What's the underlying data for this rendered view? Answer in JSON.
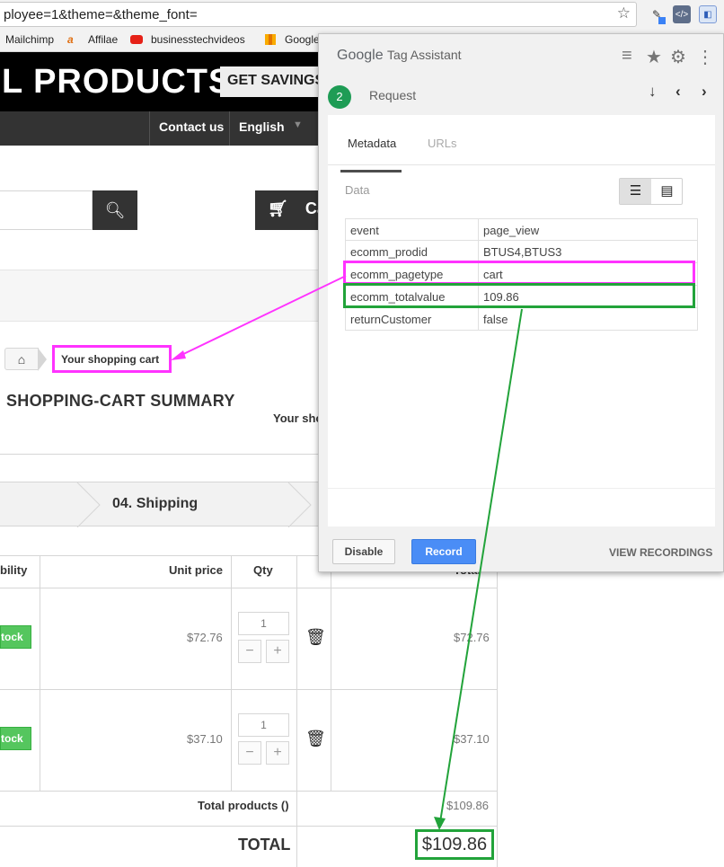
{
  "browser": {
    "url": "ployee=1&theme=&theme_font=",
    "bookmarks": [
      "Mailchimp",
      "Affilae",
      "businesstechvideos",
      "-",
      "Google"
    ]
  },
  "shop": {
    "title": "L PRODUCTS",
    "get_savings": "GET SAVINGS",
    "nav": [
      "Contact us",
      "English"
    ],
    "cart_label": "Ca",
    "breadcrumb_current": "Your shopping cart",
    "summary_title": "SHOPPING-CART SUMMARY",
    "your_sho": "Your sho",
    "step": "04. Shipping",
    "table": {
      "headers": [
        "bility",
        "Unit price",
        "Qty",
        "Total"
      ],
      "rows": [
        {
          "stock": "tock",
          "unit_price": "$72.76",
          "qty": "1",
          "total": "$72.76"
        },
        {
          "stock": "tock",
          "unit_price": "$37.10",
          "qty": "1",
          "total": "$37.10"
        }
      ],
      "total_products_label": "Total products ()",
      "total_products_value": "$109.86",
      "total_label": "TOTAL",
      "total_value": "$109.86"
    }
  },
  "tag_assistant": {
    "logo_google": "Google",
    "logo_rest": "Tag Assistant",
    "badge": "2",
    "request_label": "Request",
    "tabs": [
      "Metadata",
      "URLs"
    ],
    "data_label": "Data",
    "data_layer": [
      {
        "key": "event",
        "value": "page_view"
      },
      {
        "key": "ecomm_prodid",
        "value": "BTUS4,BTUS3"
      },
      {
        "key": "ecomm_pagetype",
        "value": "cart"
      },
      {
        "key": "ecomm_totalvalue",
        "value": "109.86"
      },
      {
        "key": "returnCustomer",
        "value": "false"
      }
    ],
    "buttons": {
      "disable": "Disable",
      "record": "Record",
      "view_recordings": "VIEW RECORDINGS"
    }
  },
  "colors": {
    "magenta_highlight": "#ff33ff",
    "green_highlight": "#22a33a",
    "record_blue": "#4a8df6",
    "badge_green": "#1e9c55",
    "stock_green": "#55c65e"
  }
}
